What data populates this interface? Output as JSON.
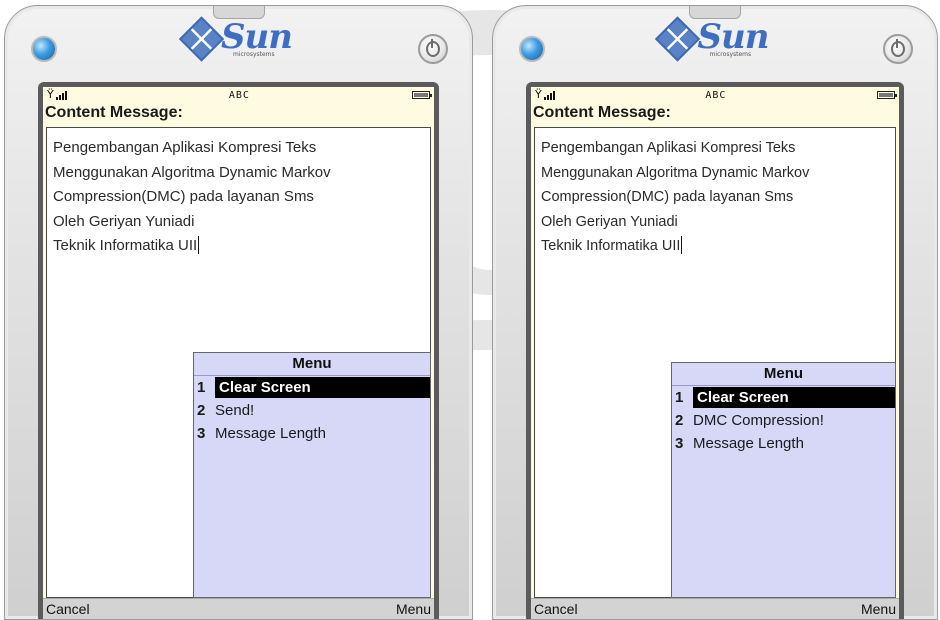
{
  "phones": [
    {
      "logo_text": "Sun",
      "logo_subtext": "microsystems",
      "status_input_mode": "ABC",
      "screen_title": "Content Message:",
      "message_lines": [
        "Pengembangan Aplikasi Kompresi Teks",
        "Menggunakan Algoritma Dynamic Markov",
        "Compression(DMC) pada layanan Sms",
        "Oleh Geriyan Yuniadi",
        "Teknik Informatika UII"
      ],
      "menu": {
        "title": "Menu",
        "items": [
          {
            "num": "1",
            "label": "Clear Screen",
            "selected": true
          },
          {
            "num": "2",
            "label": "Send!",
            "selected": false
          },
          {
            "num": "3",
            "label": "Message Length",
            "selected": false
          }
        ]
      },
      "softkeys": {
        "left": "Cancel",
        "right": "Menu"
      }
    },
    {
      "logo_text": "Sun",
      "logo_subtext": "microsystems",
      "status_input_mode": "ABC",
      "screen_title": "Content Message:",
      "message_lines": [
        "Pengembangan Aplikasi Kompresi Teks",
        "Menggunakan Algoritma Dynamic Markov",
        "Compression(DMC) pada layanan Sms",
        "Oleh Geriyan Yuniadi",
        "Teknik Informatika UII"
      ],
      "menu": {
        "title": "Menu",
        "items": [
          {
            "num": "1",
            "label": "Clear Screen",
            "selected": true
          },
          {
            "num": "2",
            "label": "DMC Compression!",
            "selected": false
          },
          {
            "num": "3",
            "label": "Message Length",
            "selected": false
          }
        ]
      },
      "softkeys": {
        "left": "Cancel",
        "right": "Menu"
      }
    }
  ],
  "colors": {
    "screen_bg": "#fffbe0",
    "menu_bg": "#d7d7f7",
    "selected_bg": "#000000",
    "brand_blue": "#3d6ec4"
  },
  "icons": [
    "led-indicator-icon",
    "sun-logo-icon",
    "power-button-icon",
    "signal-strength-icon",
    "battery-icon"
  ]
}
